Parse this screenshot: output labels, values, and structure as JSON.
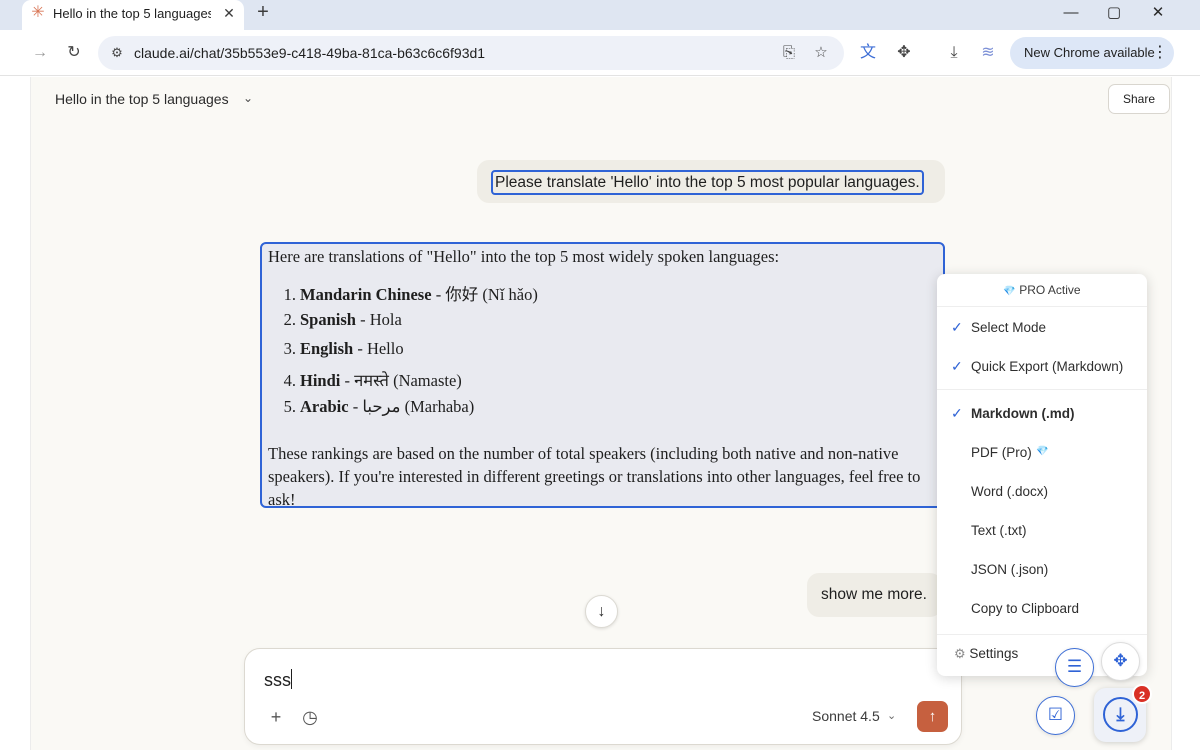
{
  "browser": {
    "tab_title": "Hello in the top 5 languages",
    "url": "claude.ai/chat/35b553e9-c418-49ba-81ca-b63c6c6f93d1",
    "update_label": "New Chrome available"
  },
  "header": {
    "conversation_title": "Hello in the top 5 languages",
    "share_label": "Share"
  },
  "messages": {
    "user_1": "Please translate 'Hello' into the top 5 most popular languages.",
    "assistant_intro": "Here are translations of \"Hello\" into the top 5 most widely spoken languages:",
    "assistant_list": [
      {
        "num": "1.",
        "language": "Mandarin Chinese",
        "translation": " - 你好 (Nǐ hǎo)"
      },
      {
        "num": "2.",
        "language": "Spanish",
        "translation": " - Hola"
      },
      {
        "num": "3.",
        "language": "English",
        "translation": " - Hello"
      },
      {
        "num": "4.",
        "language": "Hindi",
        "translation": " - नमस्ते (Namaste)"
      },
      {
        "num": "5.",
        "language": "Arabic",
        "translation": " - مرحبا (Marhaba)"
      }
    ],
    "assistant_closing": "These rankings are based on the number of total speakers (including both native and non-native speakers). If you're interested in different greetings or translations into other languages, feel free to ask!",
    "user_2": "show me more."
  },
  "composer": {
    "text": "sss",
    "model": "Sonnet 4.5"
  },
  "extension_popup": {
    "header": "PRO Active",
    "items": [
      {
        "label": "Select Mode",
        "checked": true
      },
      {
        "label": "Quick Export (Markdown)",
        "checked": true
      },
      {
        "label": "Markdown (.md)",
        "checked": true
      },
      {
        "label": "PDF (Pro)",
        "checked": false
      },
      {
        "label": "Word (.docx)",
        "checked": false
      },
      {
        "label": "Text (.txt)",
        "checked": false
      },
      {
        "label": "JSON (.json)",
        "checked": false
      },
      {
        "label": "Copy to Clipboard",
        "checked": false
      }
    ],
    "settings_label": "Settings",
    "badge_count": "2"
  },
  "colors": {
    "accent_blue": "#2f63d6",
    "send_button": "#c6603f",
    "page_bg": "#faf9f5",
    "badge_red": "#d93025"
  }
}
